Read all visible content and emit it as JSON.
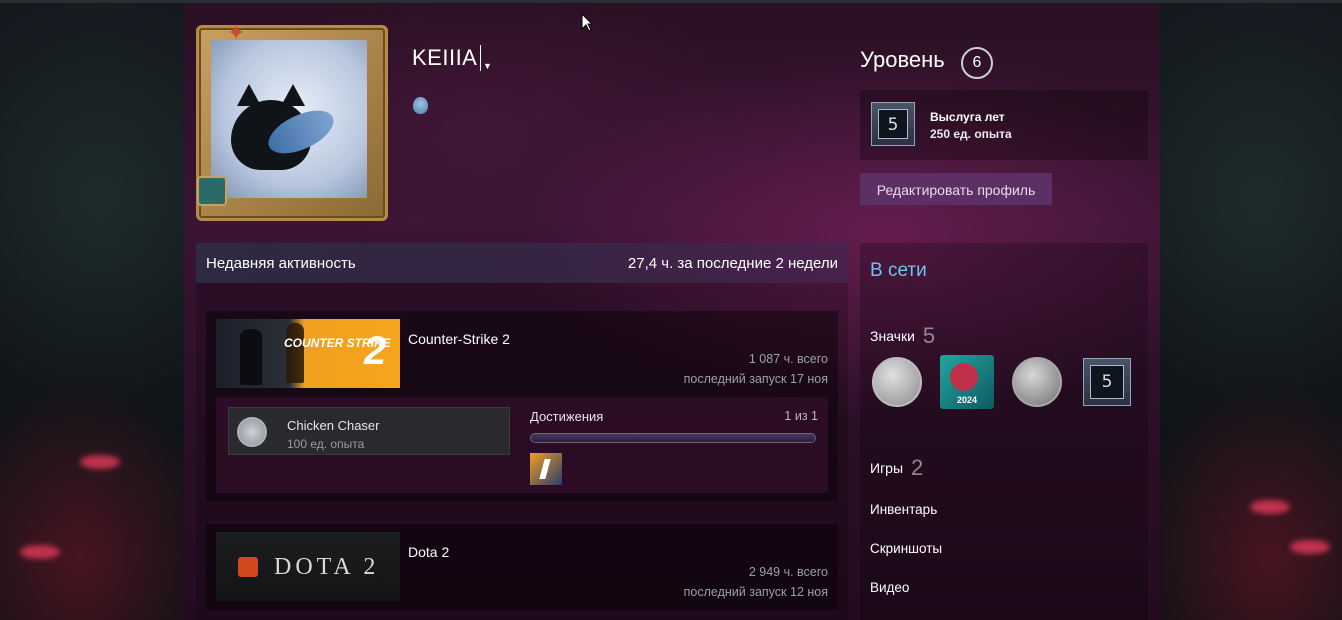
{
  "profile": {
    "persona_name": "KEIIIA",
    "level_label": "Уровень",
    "level": "6",
    "years_badge": {
      "number": "5",
      "name": "Выслуга лет",
      "xp": "250 ед. опыта"
    },
    "edit_button": "Редактировать профиль"
  },
  "activity": {
    "title": "Недавняя активность",
    "hours": "27,4 ч. за последние 2 недели",
    "games": [
      {
        "name": "Counter-Strike 2",
        "capsule_text": "COUNTER STRIKE",
        "capsule_number": "2",
        "total": "1 087 ч. всего",
        "last_played": "последний запуск 17 ноя",
        "achievement": {
          "name": "Chicken Chaser",
          "xp": "100 ед. опыта",
          "label": "Достижения",
          "count": "1 из 1",
          "progress_fraction": 1.0
        }
      },
      {
        "name": "Dota 2",
        "capsule_text": "DOTA 2",
        "total": "2 949 ч. всего",
        "last_played": "последний запуск 12 ноя"
      }
    ]
  },
  "sidebar": {
    "status": "В сети",
    "badges_label": "Значки",
    "badges_count": "5",
    "badge_2024_text": "2024",
    "badge_5_number": "5",
    "games_label": "Игры",
    "games_count": "2",
    "links": [
      "Инвентарь",
      "Скриншоты",
      "Видео"
    ]
  },
  "colors": {
    "accent_online": "#6bc4f5",
    "edit_button_bg": "#5c3065"
  }
}
